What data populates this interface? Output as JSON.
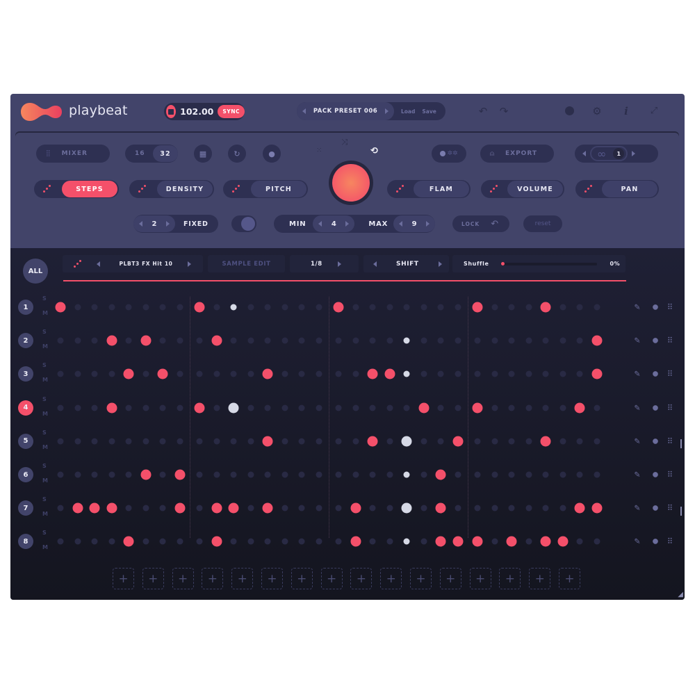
{
  "app": {
    "brand": "playbeat"
  },
  "transport": {
    "bpm": "102.00",
    "sync_label": "SYNC"
  },
  "preset": {
    "name": "PACK PRESET 006",
    "load_label": "Load",
    "save_label": "Save"
  },
  "topbar_icons": [
    "undo-icon",
    "redo-icon",
    "palette-icon",
    "gear-icon",
    "info-icon",
    "expand-icon"
  ],
  "controls": {
    "mixer_label": "MIXER",
    "step_count_options": [
      "16",
      "32"
    ],
    "step_count_selected": "32",
    "export_label": "EXPORT",
    "loop_count": "1",
    "modes": [
      {
        "label": "STEPS",
        "active": true
      },
      {
        "label": "DENSITY",
        "active": false
      },
      {
        "label": "PITCH",
        "active": false
      },
      {
        "label": "FLAM",
        "active": false
      },
      {
        "label": "VOLUME",
        "active": false
      },
      {
        "label": "PAN",
        "active": false
      }
    ],
    "fixed_value": "2",
    "fixed_label": "FIXED",
    "min_label": "MIN",
    "min_value": "4",
    "max_label": "MAX",
    "max_value": "9",
    "lock_label": "LOCK",
    "reset_label": "reset"
  },
  "sequencer": {
    "all_label": "ALL",
    "sample_name": "PLBT3 FX Hit 10",
    "sample_edit_label": "SAMPLE EDIT",
    "division": "1/8",
    "shift_label": "SHIFT",
    "shuffle_label": "Shuffle",
    "shuffle_value": "0%",
    "selected_row": 4,
    "solo_label": "S",
    "mute_label": "M",
    "steps_per_row": 32,
    "rows": [
      {
        "label": "1",
        "on": [
          0,
          8,
          16,
          24,
          28
        ],
        "white_small": [
          10
        ],
        "white_big": []
      },
      {
        "label": "2",
        "on": [
          3,
          5,
          9,
          31
        ],
        "white_small": [
          20
        ],
        "white_big": []
      },
      {
        "label": "3",
        "on": [
          4,
          6,
          12,
          18,
          19,
          31
        ],
        "white_small": [
          20
        ],
        "white_big": []
      },
      {
        "label": "4",
        "on": [
          3,
          8,
          21,
          24,
          30
        ],
        "white_small": [],
        "white_big": [
          10
        ]
      },
      {
        "label": "5",
        "on": [
          12,
          18,
          23,
          28
        ],
        "white_small": [],
        "white_big": [
          20
        ]
      },
      {
        "label": "6",
        "on": [
          5,
          7,
          22
        ],
        "white_small": [
          20
        ],
        "white_big": []
      },
      {
        "label": "7",
        "on": [
          1,
          2,
          3,
          7,
          9,
          10,
          12,
          17,
          22,
          30,
          31
        ],
        "white_small": [],
        "white_big": [
          20
        ]
      },
      {
        "label": "8",
        "on": [
          4,
          9,
          17,
          22,
          23,
          24,
          26,
          28,
          29
        ],
        "white_small": [
          20
        ],
        "white_big": []
      }
    ],
    "add_slots": 16,
    "add_symbol": "+"
  },
  "colors": {
    "accent": "#f4506a",
    "panel": "#42446a",
    "dark": "#1a1b2c"
  }
}
